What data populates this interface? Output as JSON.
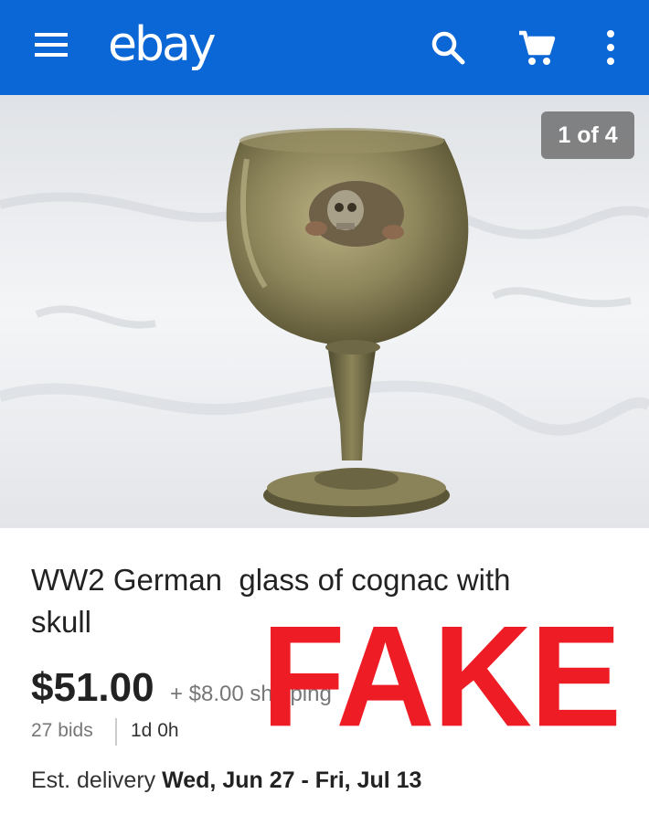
{
  "appbar": {
    "logo": "ebay",
    "icons": [
      "menu-icon",
      "search-icon",
      "cart-icon",
      "more-vert-icon"
    ],
    "background": "#0b66d6"
  },
  "gallery": {
    "counter": "1 of 4"
  },
  "listing": {
    "title_line1": "WW2 German  glass of cognac with",
    "title_line2": "skull",
    "price": "$51.00",
    "shipping": "+ $8.00 shipping",
    "bids": "27 bids",
    "time_left": "1d 0h",
    "delivery_prefix": "Est. delivery ",
    "delivery_dates": "Wed, Jun 27 - Fri, Jul 13"
  },
  "overlay": {
    "stamp": "FAKE",
    "color": "#ee1c24"
  }
}
